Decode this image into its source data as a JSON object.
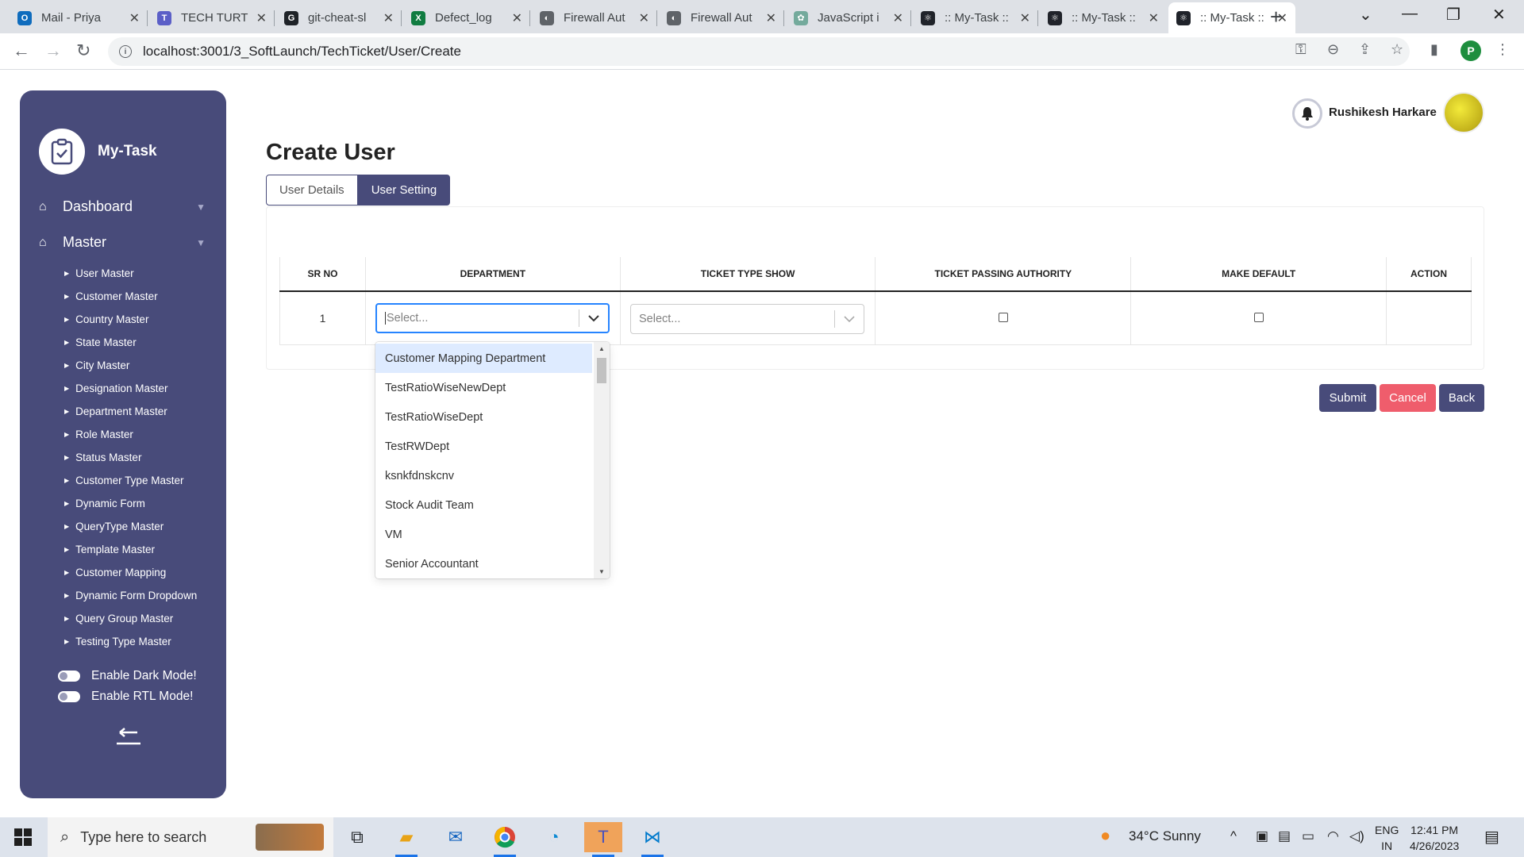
{
  "browser": {
    "tabs": [
      {
        "title": "Mail - Priya",
        "icon": "outlook-icon",
        "color": "#0f6cbd",
        "glyph": "O"
      },
      {
        "title": "TECH TURT",
        "icon": "teams-icon",
        "color": "#5b5fc7",
        "glyph": "T"
      },
      {
        "title": "git-cheat-sl",
        "icon": "github-icon",
        "color": "#1f2328",
        "glyph": "G"
      },
      {
        "title": "Defect_log",
        "icon": "excel-icon",
        "color": "#107c41",
        "glyph": "X"
      },
      {
        "title": "Firewall Aut",
        "icon": "globe-icon",
        "color": "#5f6368",
        "glyph": "◐"
      },
      {
        "title": "Firewall Aut",
        "icon": "globe-icon",
        "color": "#5f6368",
        "glyph": "◐"
      },
      {
        "title": "JavaScript i",
        "icon": "chatgpt-icon",
        "color": "#74aa9c",
        "glyph": "✿"
      },
      {
        "title": ":: My-Task ::",
        "icon": "react-icon",
        "color": "#20232a",
        "glyph": "⚛"
      },
      {
        "title": ":: My-Task ::",
        "icon": "react-icon",
        "color": "#20232a",
        "glyph": "⚛"
      },
      {
        "title": ":: My-Task ::",
        "icon": "react-icon",
        "color": "#20232a",
        "glyph": "⚛"
      }
    ],
    "url": "localhost:3001/3_SoftLaunch/TechTicket/User/Create",
    "profile_initial": "P"
  },
  "sidebar": {
    "brand": "My-Task",
    "sections": [
      {
        "label": "Dashboard"
      },
      {
        "label": "Master"
      }
    ],
    "items": [
      "User Master",
      "Customer Master",
      "Country Master",
      "State Master",
      "City Master",
      "Designation Master",
      "Department Master",
      "Role Master",
      "Status Master",
      "Customer Type Master",
      "Dynamic Form",
      "QueryType Master",
      "Template Master",
      "Customer Mapping",
      "Dynamic Form Dropdown",
      "Query Group Master",
      "Testing Type Master"
    ],
    "toggles": [
      "Enable Dark Mode!",
      "Enable RTL Mode!"
    ]
  },
  "header": {
    "user_name": "Rushikesh Harkare"
  },
  "page": {
    "title": "Create User",
    "tabs": [
      {
        "label": "User Details",
        "active": false
      },
      {
        "label": "User Setting",
        "active": true
      }
    ]
  },
  "table": {
    "columns": [
      "SR NO",
      "DEPARTMENT",
      "TICKET TYPE SHOW",
      "TICKET PASSING AUTHORITY",
      "MAKE DEFAULT",
      "ACTION"
    ],
    "rows": [
      {
        "sr_no": "1",
        "department_placeholder": "Select...",
        "ticket_type_placeholder": "Select..."
      }
    ]
  },
  "dropdown": {
    "options": [
      "Customer Mapping Department",
      "TestRatioWiseNewDept",
      "TestRatioWiseDept",
      "TestRWDept",
      "ksnkfdnskcnv",
      "Stock Audit Team",
      "VM",
      "Senior Accountant"
    ],
    "highlighted_index": 0
  },
  "buttons": {
    "submit": "Submit",
    "cancel": "Cancel",
    "back": "Back"
  },
  "colors": {
    "primary": "#484b7a",
    "cancel": "#ef5d6c",
    "focus": "#2684ff",
    "option_highlight": "#deebff"
  },
  "taskbar": {
    "search_placeholder": "Type here to search",
    "weather": "34°C  Sunny",
    "lang_top": "ENG",
    "lang_bottom": "IN",
    "time": "12:41 PM",
    "date": "4/26/2023"
  }
}
